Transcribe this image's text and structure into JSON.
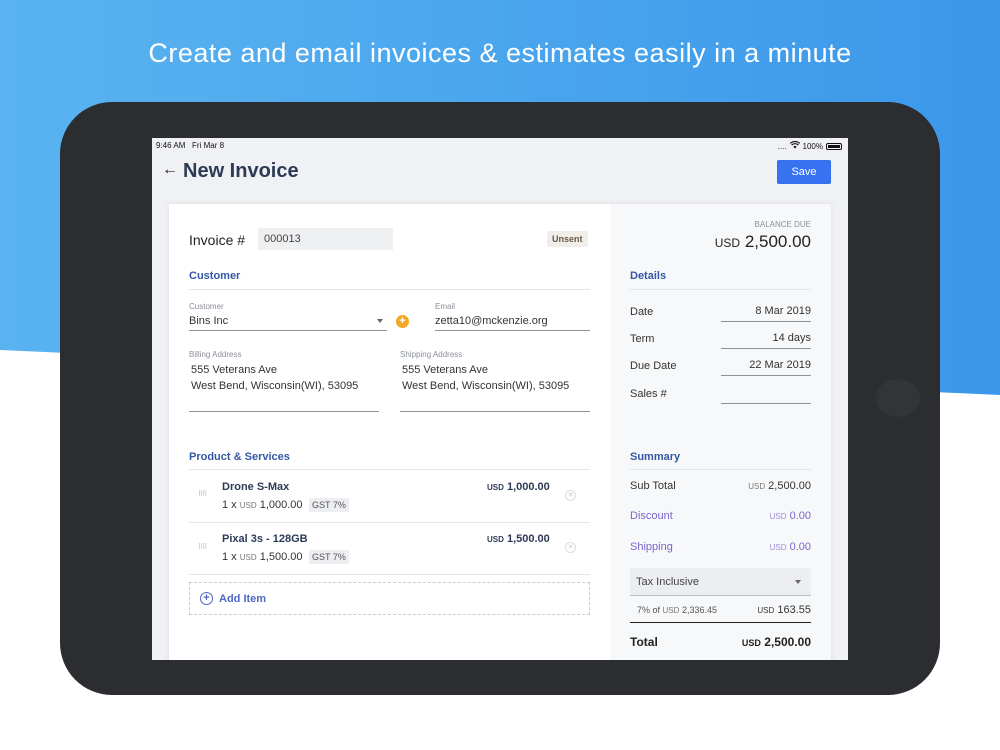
{
  "headline": "Create and email invoices & estimates easily in a minute",
  "status": {
    "time": "9:46 AM",
    "date": "Fri Mar 8",
    "signal": "....",
    "battery": "100%"
  },
  "nav": {
    "title": "New Invoice",
    "save_label": "Save"
  },
  "invoice": {
    "label": "Invoice #",
    "number": "000013",
    "status_badge": "Unsent"
  },
  "balance": {
    "label": "BALANCE DUE",
    "currency": "USD",
    "amount": "2,500.00"
  },
  "customer": {
    "section_title": "Customer",
    "customer_label": "Customer",
    "customer_value": "Bins Inc",
    "email_label": "Email",
    "email_value": "zetta10@mckenzie.org",
    "billing_label": "Billing Address",
    "billing_line1": "555 Veterans Ave",
    "billing_line2": "West Bend, Wisconsin(WI), 53095",
    "shipping_label": "Shipping Address",
    "shipping_line1": "555 Veterans Ave",
    "shipping_line2": "West Bend, Wisconsin(WI), 53095"
  },
  "products": {
    "section_title": "Product & Services",
    "items": [
      {
        "name": "Drone S-Max",
        "qty": "1 x",
        "unit_currency": "USD",
        "unit_price": "1,000.00",
        "tax": "GST 7%",
        "total_currency": "USD",
        "total": "1,000.00"
      },
      {
        "name": "Pixal 3s - 128GB",
        "qty": "1 x",
        "unit_currency": "USD",
        "unit_price": "1,500.00",
        "tax": "GST 7%",
        "total_currency": "USD",
        "total": "1,500.00"
      }
    ],
    "add_item_label": "Add Item"
  },
  "details": {
    "section_title": "Details",
    "date_label": "Date",
    "date_value": "8 Mar 2019",
    "term_label": "Term",
    "term_value": "14 days",
    "due_label": "Due Date",
    "due_value": "22 Mar 2019",
    "sales_label": "Sales #",
    "sales_value": ""
  },
  "summary": {
    "section_title": "Summary",
    "subtotal_label": "Sub Total",
    "subtotal_currency": "USD",
    "subtotal_value": "2,500.00",
    "discount_label": "Discount",
    "discount_currency": "USD",
    "discount_value": "0.00",
    "shipping_label": "Shipping",
    "shipping_currency": "USD",
    "shipping_value": "0.00",
    "tax_select": "Tax Inclusive",
    "tax_line_prefix": "7% of",
    "tax_line_currency": "USD",
    "tax_line_base": "2,336.45",
    "tax_currency": "USD",
    "tax_value": "163.55",
    "total_label": "Total",
    "total_currency": "USD",
    "total_value": "2,500.00"
  },
  "colors": {
    "accent": "#3772f0",
    "section": "#3557a3",
    "link": "#7766c9",
    "orange": "#f5a623"
  }
}
